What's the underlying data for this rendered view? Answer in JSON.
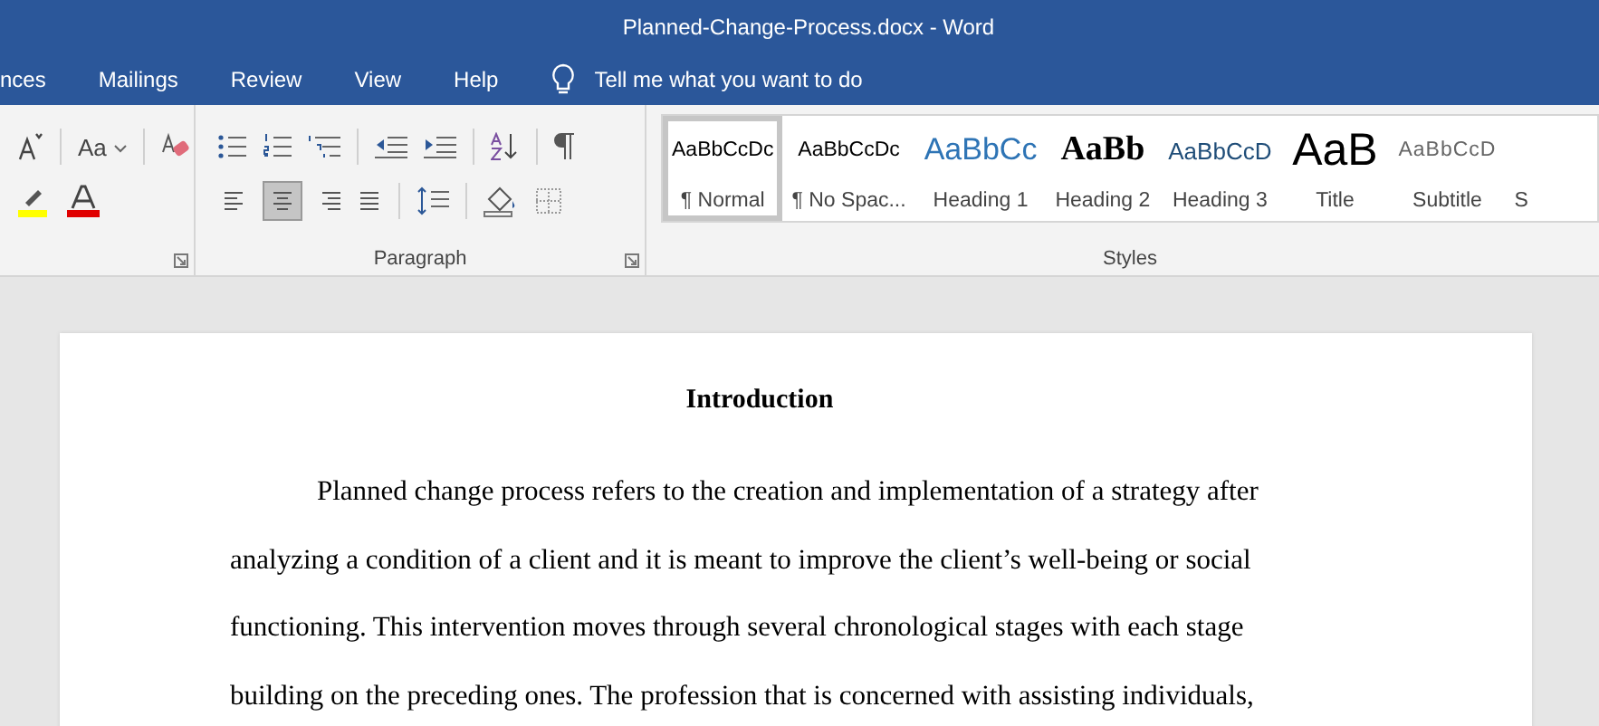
{
  "window": {
    "title": "Planned-Change-Process.docx  -  Word"
  },
  "tabs": [
    {
      "label": "nces",
      "selected": false
    },
    {
      "label": "Mailings",
      "selected": false
    },
    {
      "label": "Review",
      "selected": false
    },
    {
      "label": "View",
      "selected": false
    },
    {
      "label": "Help",
      "selected": false
    }
  ],
  "tell_me": {
    "placeholder": "Tell me what you want to do"
  },
  "font_group": {
    "change_case_label": "Aa"
  },
  "paragraph_group": {
    "label": "Paragraph",
    "alignments": [
      {
        "kind": "left",
        "selected": false
      },
      {
        "kind": "center",
        "selected": true
      },
      {
        "kind": "right",
        "selected": false
      },
      {
        "kind": "justify",
        "selected": false
      }
    ]
  },
  "styles_group": {
    "label": "Styles",
    "styles": [
      {
        "sample": "AaBbCcDc",
        "label": "¶ Normal",
        "kind": "normal",
        "selected": true
      },
      {
        "sample": "AaBbCcDc",
        "label": "¶ No Spac...",
        "kind": "normal",
        "selected": false
      },
      {
        "sample": "AaBbCc",
        "label": "Heading 1",
        "kind": "heading1",
        "selected": false
      },
      {
        "sample": "AaBb",
        "label": "Heading 2",
        "kind": "heading2",
        "selected": false
      },
      {
        "sample": "AaBbCcD",
        "label": "Heading 3",
        "kind": "heading3",
        "selected": false
      },
      {
        "sample": "AaB",
        "label": "Title",
        "kind": "title",
        "selected": false
      },
      {
        "sample": "AaBbCcD",
        "label": "Subtitle",
        "kind": "subtitle",
        "selected": false
      },
      {
        "label": "S",
        "kind": "normal",
        "selected": false
      }
    ]
  },
  "document": {
    "heading": "Introduction",
    "paragraph": "Planned change process refers to the creation and implementation of a strategy after analyzing a condition of a client and it is meant to improve the client’s well-being or social functioning. This intervention moves through several chronological stages with each stage building on the preceding ones. The profession that is concerned with assisting individuals,"
  }
}
